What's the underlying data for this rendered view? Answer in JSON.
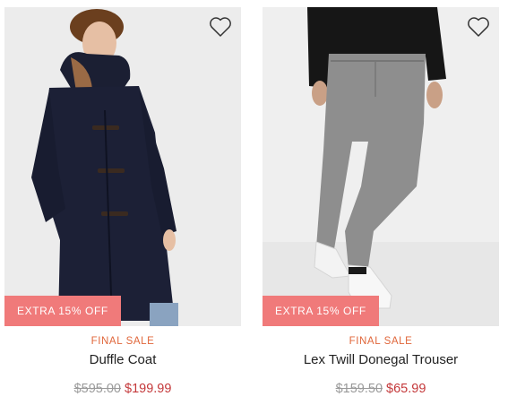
{
  "products": [
    {
      "image_alt": "",
      "wishlist_icon": "heart-outline-icon",
      "promo_badge": "EXTRA 15% OFF",
      "sale_label": "FINAL SALE",
      "name": "Duffle Coat",
      "original_price": "$595.00",
      "sale_price": "$199.99"
    },
    {
      "image_alt": "",
      "wishlist_icon": "heart-outline-icon",
      "promo_badge": "EXTRA 15% OFF",
      "sale_label": "FINAL SALE",
      "name": "Lex Twill Donegal Trouser",
      "original_price": "$159.50",
      "sale_price": "$65.99"
    }
  ],
  "colors": {
    "promo_badge_bg": "#f07a7a",
    "sale_label": "#e0663a",
    "sale_price": "#c4383a",
    "original_price": "#9a9a9a",
    "name": "#222222"
  }
}
